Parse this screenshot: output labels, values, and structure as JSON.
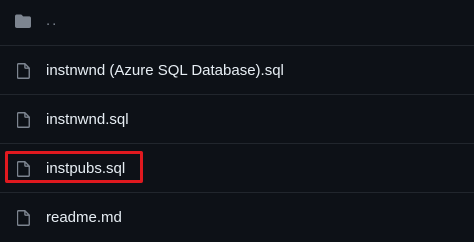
{
  "file_list": {
    "parent": {
      "label": "..",
      "icon": "folder-icon"
    },
    "files": [
      {
        "label": "instnwnd (Azure SQL Database).sql",
        "icon": "file-icon"
      },
      {
        "label": "instnwnd.sql",
        "icon": "file-icon"
      },
      {
        "label": "instpubs.sql",
        "icon": "file-icon",
        "highlighted": true
      },
      {
        "label": "readme.md",
        "icon": "file-icon"
      }
    ]
  },
  "colors": {
    "background": "#0d1117",
    "text": "#e6edf3",
    "muted": "#7d8590",
    "divider": "#21262d",
    "highlight_border": "#e0191f"
  }
}
